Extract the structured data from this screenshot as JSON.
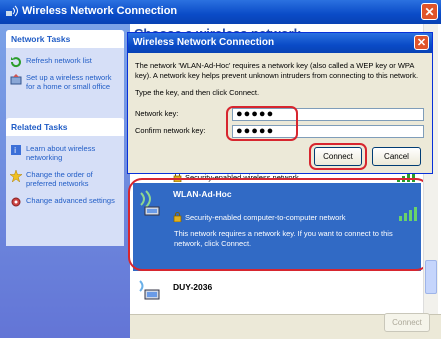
{
  "outer_window": {
    "title": "Wireless Network Connection",
    "content_title": "Choose a wireless network"
  },
  "left_panel": {
    "network_tasks": {
      "title": "Network Tasks",
      "items": [
        "Refresh network list",
        "Set up a wireless network for a home or small office"
      ]
    },
    "related_tasks": {
      "title": "Related Tasks",
      "items": [
        "Learn about wireless networking",
        "Change the order of preferred networks",
        "Change advanced settings"
      ]
    }
  },
  "networks": [
    {
      "name": "",
      "security": "Security-enabled wireless network",
      "signal_bars": 4
    },
    {
      "name": "WLAN-Ad-Hoc",
      "security": "Security-enabled computer-to-computer network",
      "detail": "This network requires a network key. If you want to connect to this network, click Connect.",
      "signal_bars": 4,
      "selected": true
    },
    {
      "name": "DUY-2036"
    }
  ],
  "bottom": {
    "connect_label": "Connect"
  },
  "dialog": {
    "title": "Wireless Network Connection",
    "message": "The network 'WLAN-Ad-Hoc' requires a network key (also called a WEP key or WPA key). A network key helps prevent unknown intruders from connecting to this network.",
    "instruction": "Type the key, and then click Connect.",
    "network_key_label": "Network key:",
    "network_key_value": "●●●●●",
    "confirm_key_label": "Confirm network key:",
    "confirm_key_value": "●●●●●",
    "connect_label": "Connect",
    "cancel_label": "Cancel"
  },
  "colors": {
    "title_bar": "#0a4bc7",
    "selection": "#316ac5",
    "highlight_ring": "#d7262f",
    "task_link": "#215dc6"
  }
}
